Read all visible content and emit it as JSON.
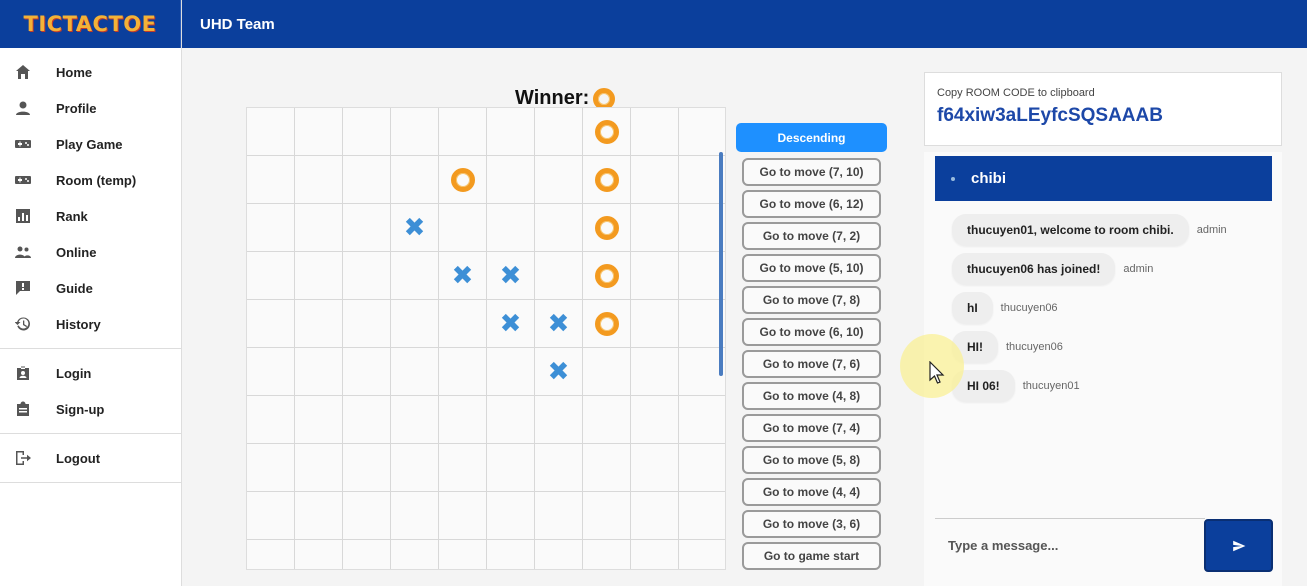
{
  "app": {
    "logo": "TICTACTOE",
    "team": "UHD Team"
  },
  "sidebar": {
    "groups": [
      [
        {
          "label": "Home",
          "icon": "home-icon"
        },
        {
          "label": "Profile",
          "icon": "person-icon"
        },
        {
          "label": "Play Game",
          "icon": "gamepad-icon"
        },
        {
          "label": "Room (temp)",
          "icon": "gamepad-icon"
        },
        {
          "label": "Rank",
          "icon": "bar-chart-icon"
        },
        {
          "label": "Online",
          "icon": "people-icon"
        },
        {
          "label": "Guide",
          "icon": "feedback-icon"
        },
        {
          "label": "History",
          "icon": "history-icon"
        }
      ],
      [
        {
          "label": "Login",
          "icon": "badge-icon"
        },
        {
          "label": "Sign-up",
          "icon": "clipboard-icon"
        }
      ],
      [
        {
          "label": "Logout",
          "icon": "logout-icon"
        }
      ]
    ]
  },
  "game": {
    "winner_label": "Winner:",
    "winner_mark": "O",
    "board": [
      [
        "",
        "",
        "",
        "",
        "",
        "",
        "",
        "O",
        "",
        ""
      ],
      [
        "",
        "",
        "",
        "",
        "O",
        "",
        "",
        "O",
        "",
        ""
      ],
      [
        "",
        "",
        "",
        "X",
        "",
        "",
        "",
        "O",
        "",
        ""
      ],
      [
        "",
        "",
        "",
        "",
        "X",
        "X",
        "",
        "O",
        "",
        ""
      ],
      [
        "",
        "",
        "",
        "",
        "",
        "X",
        "X",
        "O",
        "",
        ""
      ],
      [
        "",
        "",
        "",
        "",
        "",
        "",
        "X",
        "",
        "",
        ""
      ],
      [
        "",
        "",
        "",
        "",
        "",
        "",
        "",
        "",
        "",
        ""
      ],
      [
        "",
        "",
        "",
        "",
        "",
        "",
        "",
        "",
        "",
        ""
      ],
      [
        "",
        "",
        "",
        "",
        "",
        "",
        "",
        "",
        "",
        ""
      ],
      [
        "",
        "",
        "",
        "",
        "",
        "",
        "",
        "",
        "",
        ""
      ]
    ],
    "sort_label": "Descending",
    "moves": [
      "Go to move (7, 10)",
      "Go to move (6, 12)",
      "Go to move (7, 2)",
      "Go to move (5, 10)",
      "Go to move (7, 8)",
      "Go to move (6, 10)",
      "Go to move (7, 6)",
      "Go to move (4, 8)",
      "Go to move (7, 4)",
      "Go to move (5, 8)",
      "Go to move (4, 4)",
      "Go to move (3, 6)",
      "Go to game start"
    ]
  },
  "room": {
    "copy_label": "Copy ROOM CODE to clipboard",
    "code": "f64xiw3aLEyfcSQSAAAB"
  },
  "chat": {
    "room_name": "chibi",
    "messages": [
      {
        "text": "thucuyen01, welcome to room chibi.",
        "sender": "admin"
      },
      {
        "text": "thucuyen06 has joined!",
        "sender": "admin"
      },
      {
        "text": "hI",
        "sender": "thucuyen06"
      },
      {
        "text": "HI!",
        "sender": "thucuyen06"
      },
      {
        "text": "HI 06!",
        "sender": "thucuyen01"
      }
    ],
    "placeholder": "Type a message..."
  }
}
